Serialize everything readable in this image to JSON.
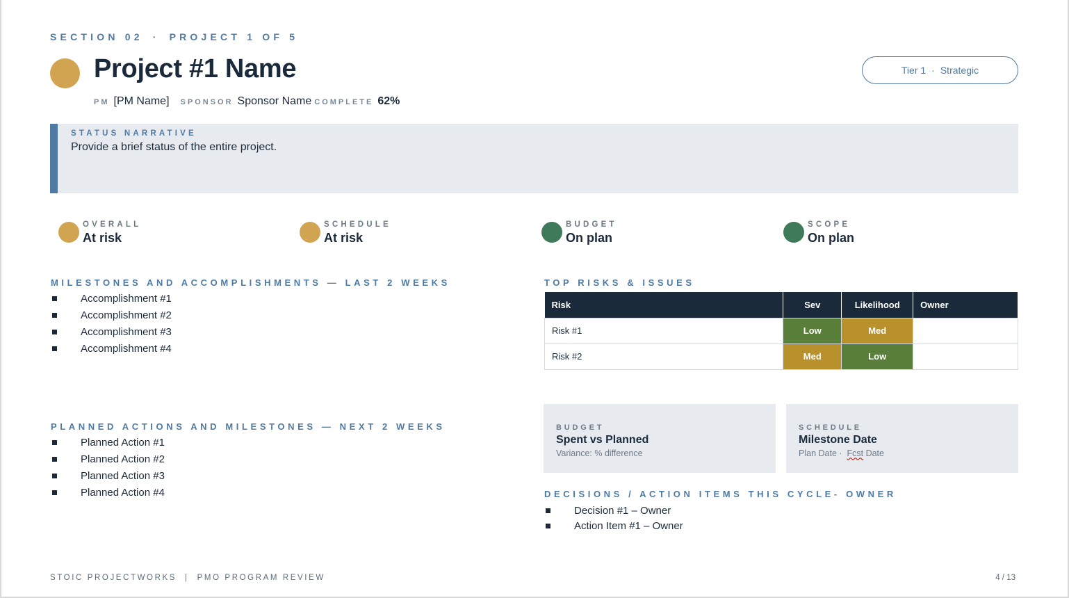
{
  "header": {
    "section": "SECTION 02",
    "separator": "·",
    "project_of": "PROJECT 1 OF 5",
    "title": "Project #1 Name",
    "title_dot_color": "#d1a451",
    "tier": "Tier 1",
    "tier_sep": "·",
    "tier_type": "Strategic"
  },
  "meta": {
    "pm_label": "PM",
    "pm_value": "[PM Name]",
    "sponsor_label": "SPONSOR",
    "sponsor_value": "Sponsor Name",
    "complete_label": "COMPLETE",
    "complete_value": "62%"
  },
  "narrative": {
    "label": "STATUS NARRATIVE",
    "text": "Provide a brief status of the entire project."
  },
  "status": [
    {
      "label": "OVERALL",
      "value": "At risk",
      "color": "#d1a451"
    },
    {
      "label": "SCHEDULE",
      "value": "At risk",
      "color": "#d1a451"
    },
    {
      "label": "BUDGET",
      "value": "On plan",
      "color": "#3f7a5b"
    },
    {
      "label": "SCOPE",
      "value": "On plan",
      "color": "#3f7a5b"
    }
  ],
  "milestones": {
    "heading": "MILESTONES AND ACCOMPLISHMENTS — LAST 2 WEEKS",
    "items": [
      "Accomplishment #1",
      "Accomplishment #2",
      "Accomplishment #3",
      "Accomplishment #4"
    ]
  },
  "planned": {
    "heading": "PLANNED ACTIONS AND MILESTONES — NEXT 2 WEEKS",
    "items": [
      "Planned Action #1",
      "Planned Action #2",
      "Planned Action #3",
      "Planned Action #4"
    ]
  },
  "risks": {
    "heading": "TOP RISKS & ISSUES",
    "columns": [
      "Risk",
      "Sev",
      "Likelihood",
      "Owner"
    ],
    "rows": [
      {
        "risk": "Risk #1",
        "sev": "Low",
        "likelihood": "Med",
        "owner": ""
      },
      {
        "risk": "Risk #2",
        "sev": "Med",
        "likelihood": "Low",
        "owner": ""
      }
    ]
  },
  "metrics": {
    "budget": {
      "label": "BUDGET",
      "title": "Spent vs Planned",
      "sub": "Variance: % difference"
    },
    "schedule": {
      "label": "SCHEDULE",
      "title": "Milestone Date",
      "sub_a": "Plan Date ·",
      "sub_b": "Fcst",
      "sub_c": "Date"
    }
  },
  "decisions": {
    "heading": "DECISIONS / ACTION ITEMS THIS CYCLE- OWNER",
    "items": [
      "Decision #1 – Owner",
      "Action Item #1 – Owner"
    ]
  },
  "footer": {
    "org": "STOIC PROJECTWORKS",
    "pipe": "|",
    "review": "PMO PROGRAM REVIEW",
    "page": "4 / 13"
  }
}
